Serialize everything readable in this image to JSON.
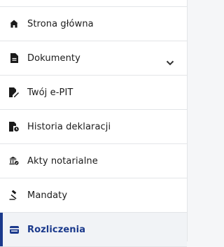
{
  "sidebar": {
    "items": [
      {
        "label": "Strona główna",
        "icon": "home-icon"
      },
      {
        "label": "Dokumenty",
        "icon": "document-icon",
        "expandable": true
      },
      {
        "label": "Twój e-PIT",
        "icon": "document-pen-icon"
      },
      {
        "label": "Historia deklaracji",
        "icon": "document-history-icon"
      },
      {
        "label": "Akty notarialne",
        "icon": "notary-building-icon"
      },
      {
        "label": "Mandaty",
        "icon": "gavel-icon"
      },
      {
        "label": "Rozliczenia",
        "icon": "wallet-icon",
        "active": true
      }
    ]
  },
  "colors": {
    "accent": "#1b3a8c",
    "text": "#1b1b1b",
    "divider": "#e3e5e8",
    "content_bg": "#f5f6f8"
  }
}
